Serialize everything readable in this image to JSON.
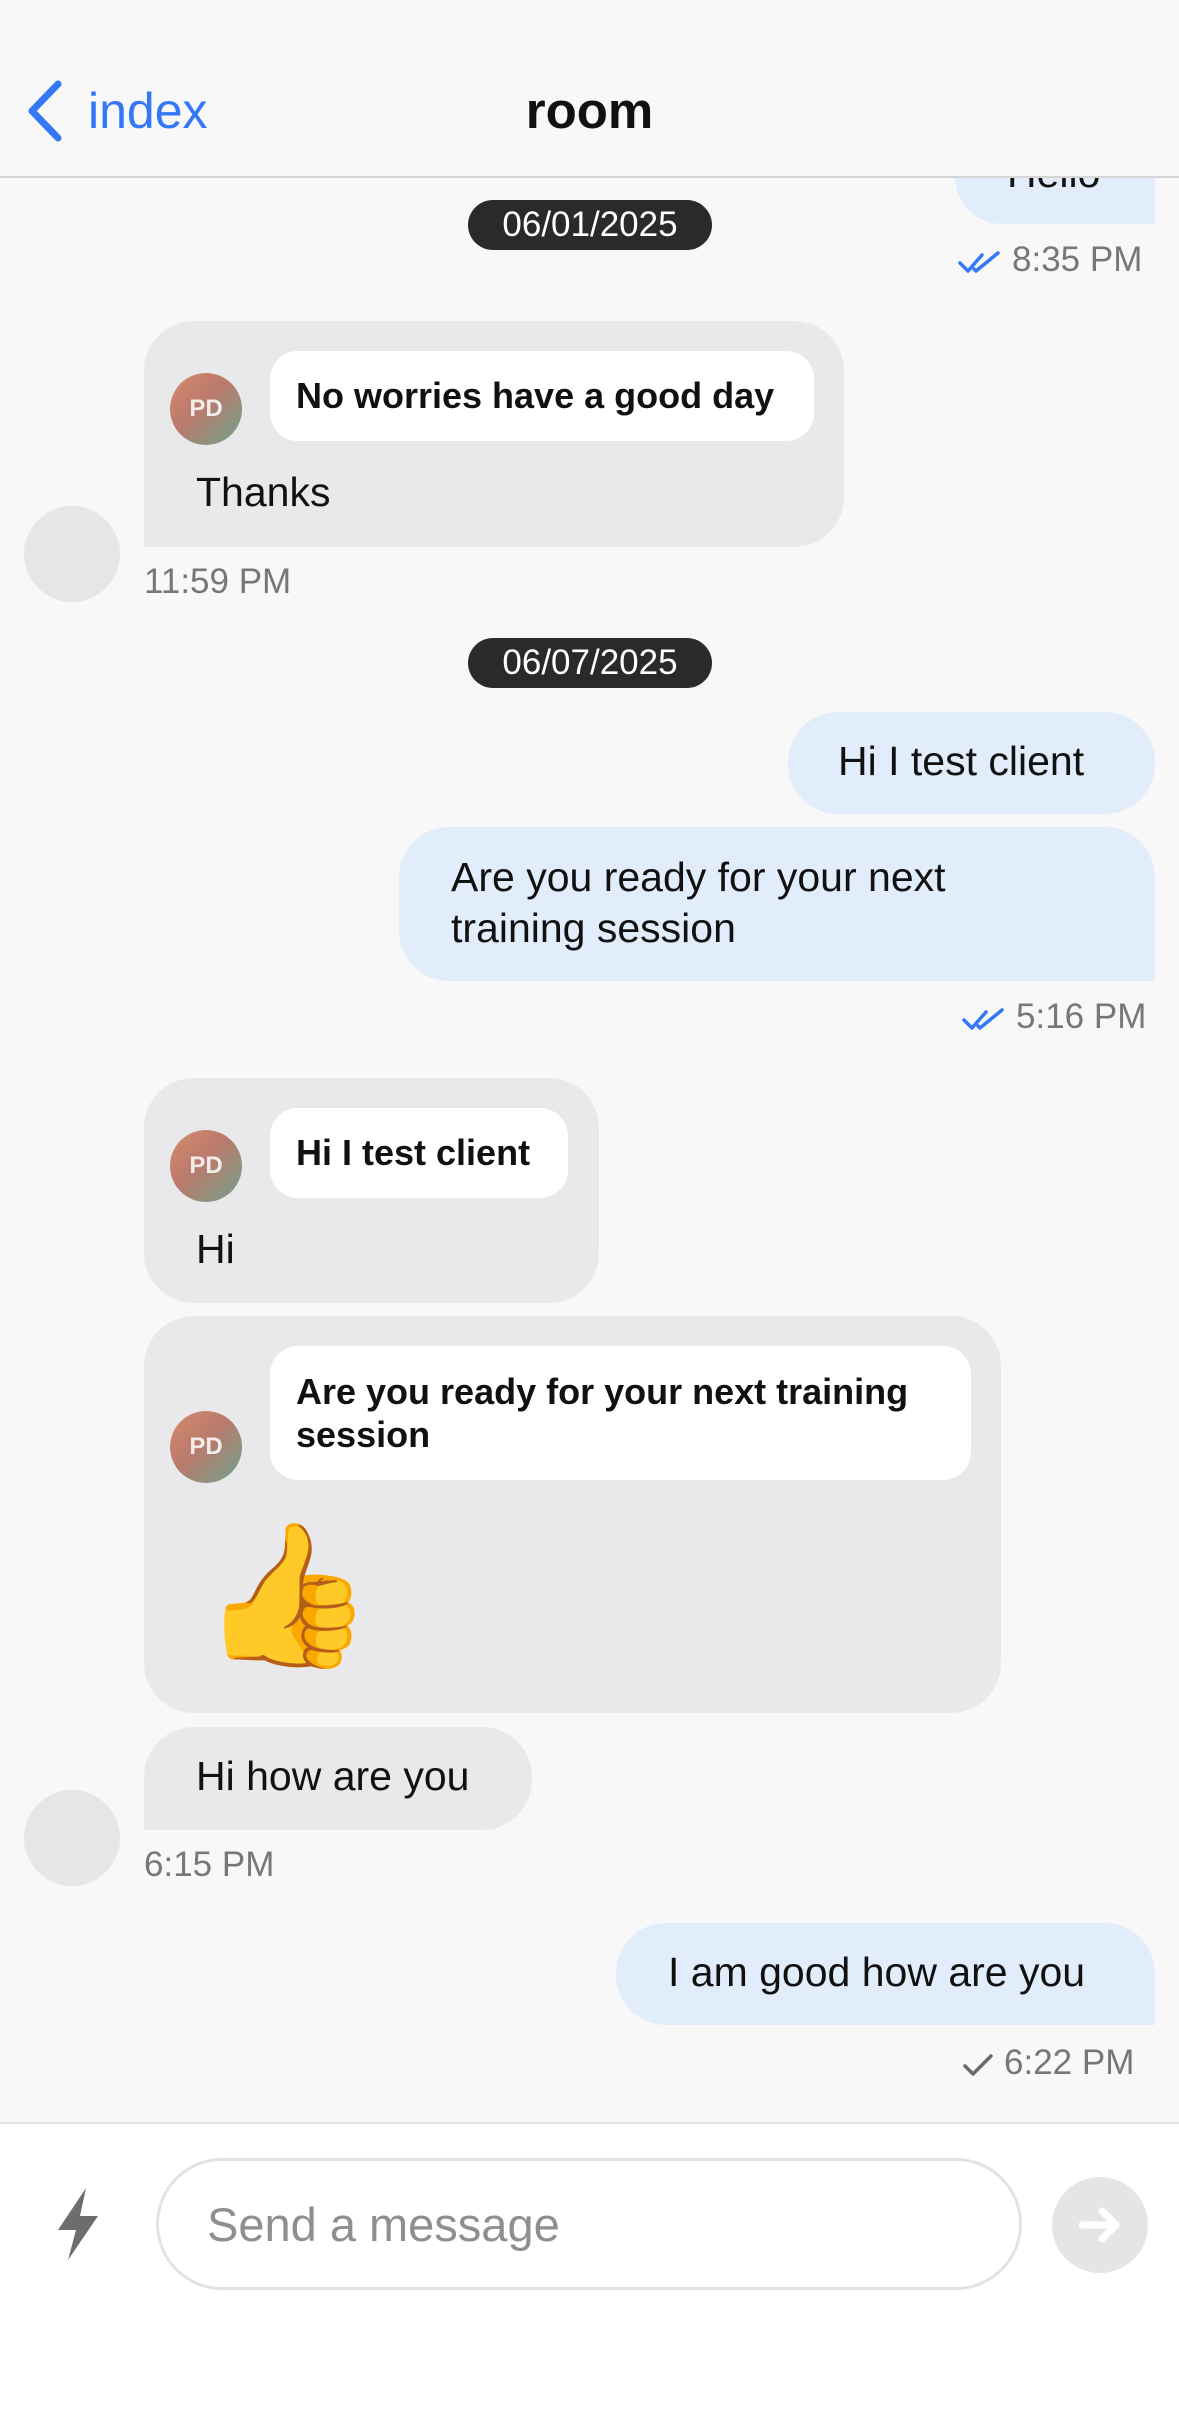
{
  "header": {
    "back_label": "index",
    "title": "room"
  },
  "messages": {
    "top_partial": {
      "text": "Hello",
      "time": "8:35 PM"
    },
    "date1": "06/01/2025",
    "incoming1": {
      "avatar_initials": "PD",
      "quote": "No worries have a good day",
      "text": "Thanks",
      "time": "11:59 PM"
    },
    "date2": "06/07/2025",
    "outgoing1": {
      "text": "Hi I test client"
    },
    "outgoing2": {
      "line1": "Are you ready for your next",
      "line2": "training session",
      "time": "5:16 PM"
    },
    "incoming2": {
      "avatar_initials": "PD",
      "quote": "Hi I test client",
      "text": "Hi"
    },
    "incoming3": {
      "avatar_initials": "PD",
      "quote_line1": "Are you ready for your next training",
      "quote_line2": "session",
      "emoji": "👍"
    },
    "incoming4": {
      "text": "Hi how are you",
      "time": "6:15 PM"
    },
    "outgoing3": {
      "text": "I am good how are you",
      "time": "6:22 PM"
    }
  },
  "composer": {
    "placeholder": "Send a message"
  },
  "colors": {
    "accent": "#3478f6",
    "outgoing_bubble": "#e2edfb",
    "incoming_bubble": "#e9e9eb",
    "date_pill": "#2a2a2a"
  },
  "icons": {
    "back": "chevron-left-icon",
    "read_receipt": "double-check-icon",
    "sent_receipt": "check-icon",
    "quick_actions": "lightning-bolt-icon",
    "send": "arrow-right-icon"
  }
}
